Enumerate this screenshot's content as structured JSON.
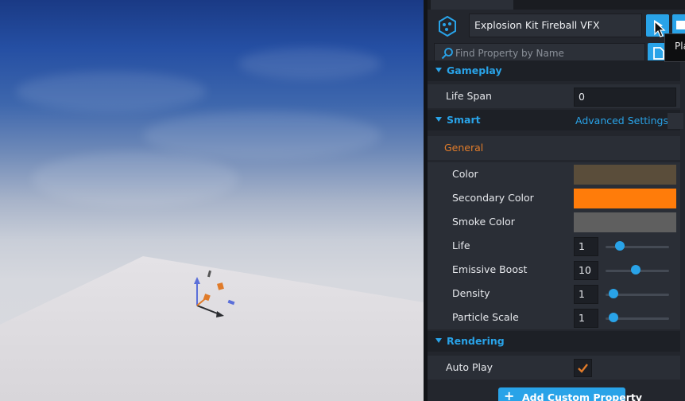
{
  "header": {
    "object_name": "Explosion Kit Fireball VFX",
    "search_placeholder": "Find Property by Name",
    "tooltip_text": "Pla"
  },
  "sections": {
    "gameplay": {
      "title": "Gameplay",
      "life_span": {
        "label": "Life Span",
        "value": "0"
      }
    },
    "smart": {
      "title": "Smart",
      "advanced_link": "Advanced Settings",
      "group_label": "General",
      "color": {
        "label": "Color",
        "value": "#5a4d3a"
      },
      "secondary_color": {
        "label": "Secondary Color",
        "value": "#ff7c0a"
      },
      "smoke_color": {
        "label": "Smoke Color",
        "value": "#5f5f5f"
      },
      "life": {
        "label": "Life",
        "value": "1",
        "slider_fraction": 0.22
      },
      "emissive_boost": {
        "label": "Emissive Boost",
        "value": "10",
        "slider_fraction": 0.47
      },
      "density": {
        "label": "Density",
        "value": "1",
        "slider_fraction": 0.12
      },
      "particle_scale": {
        "label": "Particle Scale",
        "value": "1",
        "slider_fraction": 0.12
      }
    },
    "rendering": {
      "title": "Rendering",
      "auto_play": {
        "label": "Auto Play",
        "checked": true
      }
    }
  },
  "footer": {
    "add_button_label": "Add Custom Property"
  },
  "colors": {
    "accent": "#29a3e8",
    "group_orange": "#e07b2a"
  },
  "icons": [
    "vfx-object-icon",
    "play-icon",
    "stop-icon",
    "file-icon",
    "search-icon",
    "caret-down-icon",
    "checkmark-icon",
    "plus-icon",
    "mouse-cursor-icon"
  ]
}
